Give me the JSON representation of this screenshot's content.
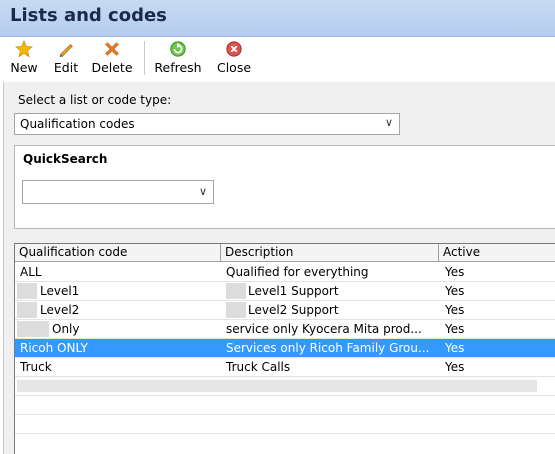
{
  "window": {
    "title": "Lists and codes"
  },
  "toolbar": {
    "new_label": "New",
    "edit_label": "Edit",
    "delete_label": "Delete",
    "refresh_label": "Refresh",
    "close_label": "Close"
  },
  "selector": {
    "label": "Select a list or code type:",
    "value": "Qualification codes"
  },
  "quicksearch": {
    "title": "QuickSearch",
    "value": ""
  },
  "grid": {
    "columns": [
      "Qualification code",
      "Description",
      "Active"
    ],
    "rows": [
      {
        "code": "ALL",
        "description": "Qualified for everything",
        "active": "Yes"
      },
      {
        "code": "Level1",
        "description": "Level1 Support",
        "active": "Yes"
      },
      {
        "code": "Level2",
        "description": "Level2 Support",
        "active": "Yes"
      },
      {
        "code": "Only",
        "description": "service only Kyocera Mita prod...",
        "active": "Yes"
      },
      {
        "code": "Ricoh ONLY",
        "description": "Services only Ricoh Family Grou...",
        "active": "Yes"
      },
      {
        "code": "Truck",
        "description": "Truck Calls",
        "active": "Yes"
      }
    ],
    "selected_index": 4
  },
  "colors": {
    "titlebar": "#b4cdef",
    "selection": "#3399ff",
    "star": "#f5b800",
    "delete": "#ef7a1a",
    "refresh": "#3fae2a",
    "close": "#d9534f"
  },
  "icons": {
    "new": "star-icon",
    "edit": "pencil-icon",
    "delete": "x-icon",
    "refresh": "refresh-icon",
    "close": "close-circle-icon"
  }
}
